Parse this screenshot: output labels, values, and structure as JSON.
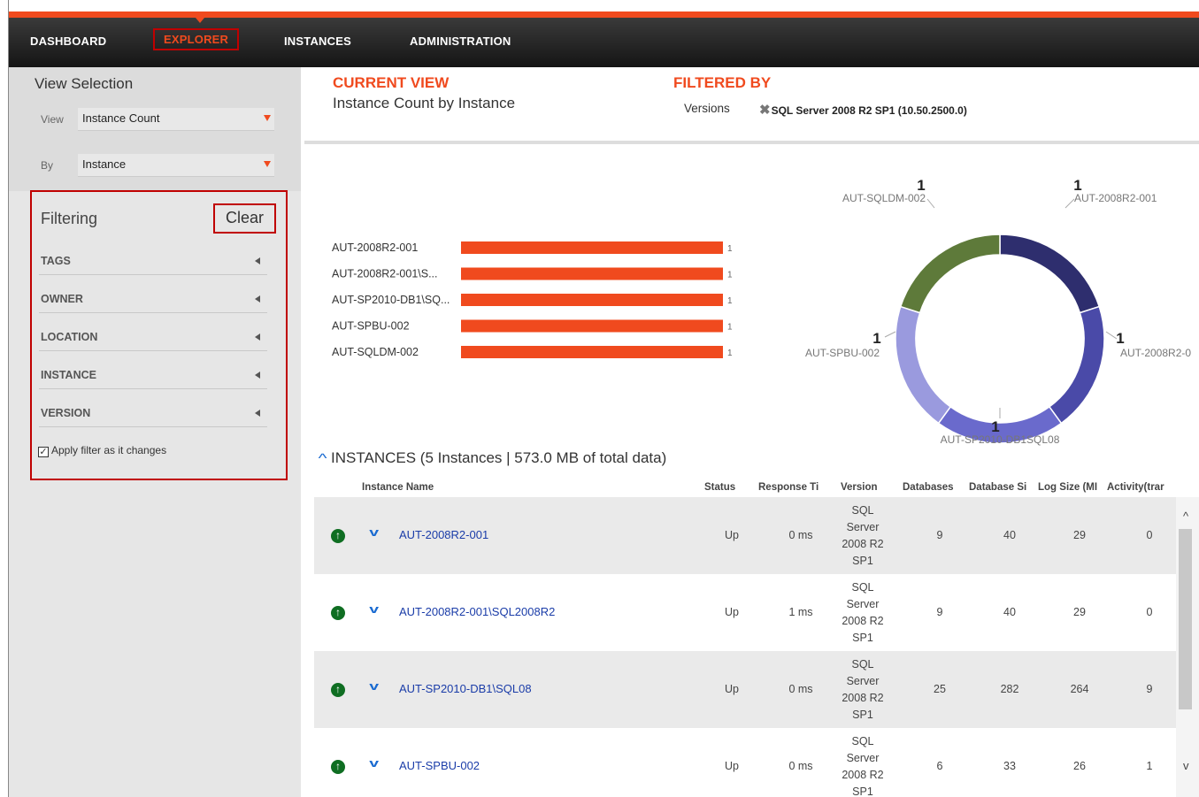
{
  "nav": {
    "items": [
      "DASHBOARD",
      "EXPLORER",
      "INSTANCES",
      "ADMINISTRATION"
    ],
    "active": "EXPLORER"
  },
  "view_selection": {
    "title": "View Selection",
    "view_label": "View",
    "view_value": "Instance Count",
    "by_label": "By",
    "by_value": "Instance"
  },
  "filtering": {
    "title": "Filtering",
    "clear_label": "Clear",
    "groups": [
      "TAGS",
      "OWNER",
      "LOCATION",
      "INSTANCE",
      "VERSION"
    ],
    "apply_label": "Apply filter as it changes",
    "apply_checked": true
  },
  "current_view": {
    "title": "CURRENT VIEW",
    "value": "Instance Count by Instance"
  },
  "filtered_by": {
    "title": "FILTERED BY",
    "label": "Versions",
    "chip": "SQL Server 2008 R2 SP1 (10.50.2500.0)"
  },
  "colors": {
    "accent": "#f04a1e",
    "link": "#1a3ca8",
    "donut": [
      "#2e2e6e",
      "#4a4aa8",
      "#6a6acc",
      "#9a9ade",
      "#5e7a3a"
    ]
  },
  "chart_data": [
    {
      "type": "bar",
      "orientation": "horizontal",
      "categories": [
        "AUT-2008R2-001",
        "AUT-2008R2-001\\S...",
        "AUT-SP2010-DB1\\SQ...",
        "AUT-SPBU-002",
        "AUT-SQLDM-002"
      ],
      "values": [
        1,
        1,
        1,
        1,
        1
      ],
      "xlim": [
        0,
        1
      ]
    },
    {
      "type": "pie",
      "donut": true,
      "categories": [
        "AUT-2008R2-001",
        "AUT-2008R2-0",
        "AUT-SP2010-DB1SQL08",
        "AUT-SPBU-002",
        "AUT-SQLDM-002"
      ],
      "values": [
        1,
        1,
        1,
        1,
        1
      ]
    }
  ],
  "instances": {
    "header": "INSTANCES (5 Instances | 573.0 MB of total data)",
    "columns": [
      "Instance Name",
      "Status",
      "Response Ti",
      "Version",
      "Databases",
      "Database Si",
      "Log Size (MI",
      "Activity(trar"
    ],
    "rows": [
      {
        "name": "AUT-2008R2-001",
        "status": "Up",
        "response": "0 ms",
        "version": [
          "SQL",
          "Server",
          "2008 R2",
          "SP1"
        ],
        "databases": "9",
        "db_size": "40",
        "log_size": "29",
        "activity": "0"
      },
      {
        "name": "AUT-2008R2-001\\SQL2008R2",
        "status": "Up",
        "response": "1 ms",
        "version": [
          "SQL",
          "Server",
          "2008 R2",
          "SP1"
        ],
        "databases": "9",
        "db_size": "40",
        "log_size": "29",
        "activity": "0"
      },
      {
        "name": "AUT-SP2010-DB1\\SQL08",
        "status": "Up",
        "response": "0 ms",
        "version": [
          "SQL",
          "Server",
          "2008 R2",
          "SP1"
        ],
        "databases": "25",
        "db_size": "282",
        "log_size": "264",
        "activity": "9"
      },
      {
        "name": "AUT-SPBU-002",
        "status": "Up",
        "response": "0 ms",
        "version": [
          "SQL",
          "Server",
          "2008 R2",
          "SP1"
        ],
        "databases": "6",
        "db_size": "33",
        "log_size": "26",
        "activity": "1"
      }
    ]
  },
  "icons": {
    "status_up": "arrow-up-circle-icon",
    "expand": "chevron-down-icon",
    "collapse": "chevron-up-icon",
    "filter_group": "caret-left-icon",
    "remove_filter": "close-icon"
  }
}
